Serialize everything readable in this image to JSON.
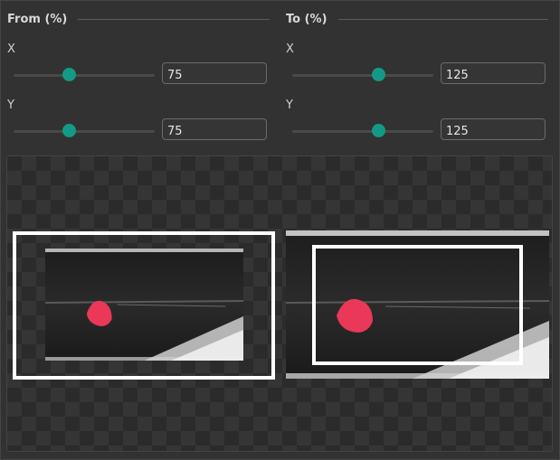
{
  "from": {
    "title": "From (%)",
    "x": {
      "label": "X",
      "value": "75",
      "level": 0.39
    },
    "y": {
      "label": "Y",
      "value": "75",
      "level": 0.39
    }
  },
  "to": {
    "title": "To (%)",
    "x": {
      "label": "X",
      "value": "125",
      "level": 0.61
    },
    "y": {
      "label": "Y",
      "value": "125",
      "level": 0.61
    }
  },
  "colors": {
    "accent": "#139a86",
    "marker": "#ea3859"
  }
}
